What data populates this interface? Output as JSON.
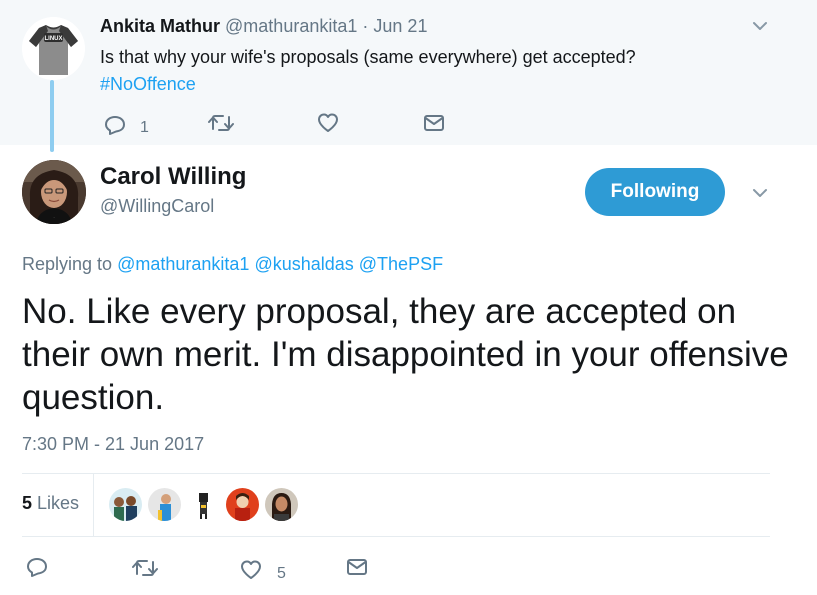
{
  "parent_tweet": {
    "name": "Ankita Mathur",
    "handle": "@mathurankita1",
    "separator": "·",
    "date": "Jun 21",
    "text": "Is that why your wife's proposals (same everywhere) get accepted?",
    "hashtag": "#NoOffence",
    "reply_count": "1",
    "avatar_text": "LINUX",
    "avatar_icon": "linux-tshirt"
  },
  "main_tweet": {
    "name": "Carol Willing",
    "handle": "@WillingCarol",
    "follow_label": "Following",
    "replying_label": "Replying to",
    "mentions": [
      "@mathurankita1",
      "@kushaldas",
      "@ThePSF"
    ],
    "text": "No. Like every proposal, they are accepted on their own merit. I'm disappointed in your offensive question.",
    "timestamp": "7:30 PM - 21 Jun 2017",
    "likes_count": "5",
    "likes_label": "Likes",
    "like_action_count": "5"
  },
  "icons": [
    "reply-icon",
    "retweet-icon",
    "heart-icon",
    "dm-envelope-icon",
    "chevron-down-icon"
  ],
  "colors": {
    "link": "#1da1f2",
    "follow_button": "#2e9bd5",
    "thread_line": "#8ecdf0",
    "muted": "#657786",
    "parent_bg": "#f5f8fa"
  }
}
